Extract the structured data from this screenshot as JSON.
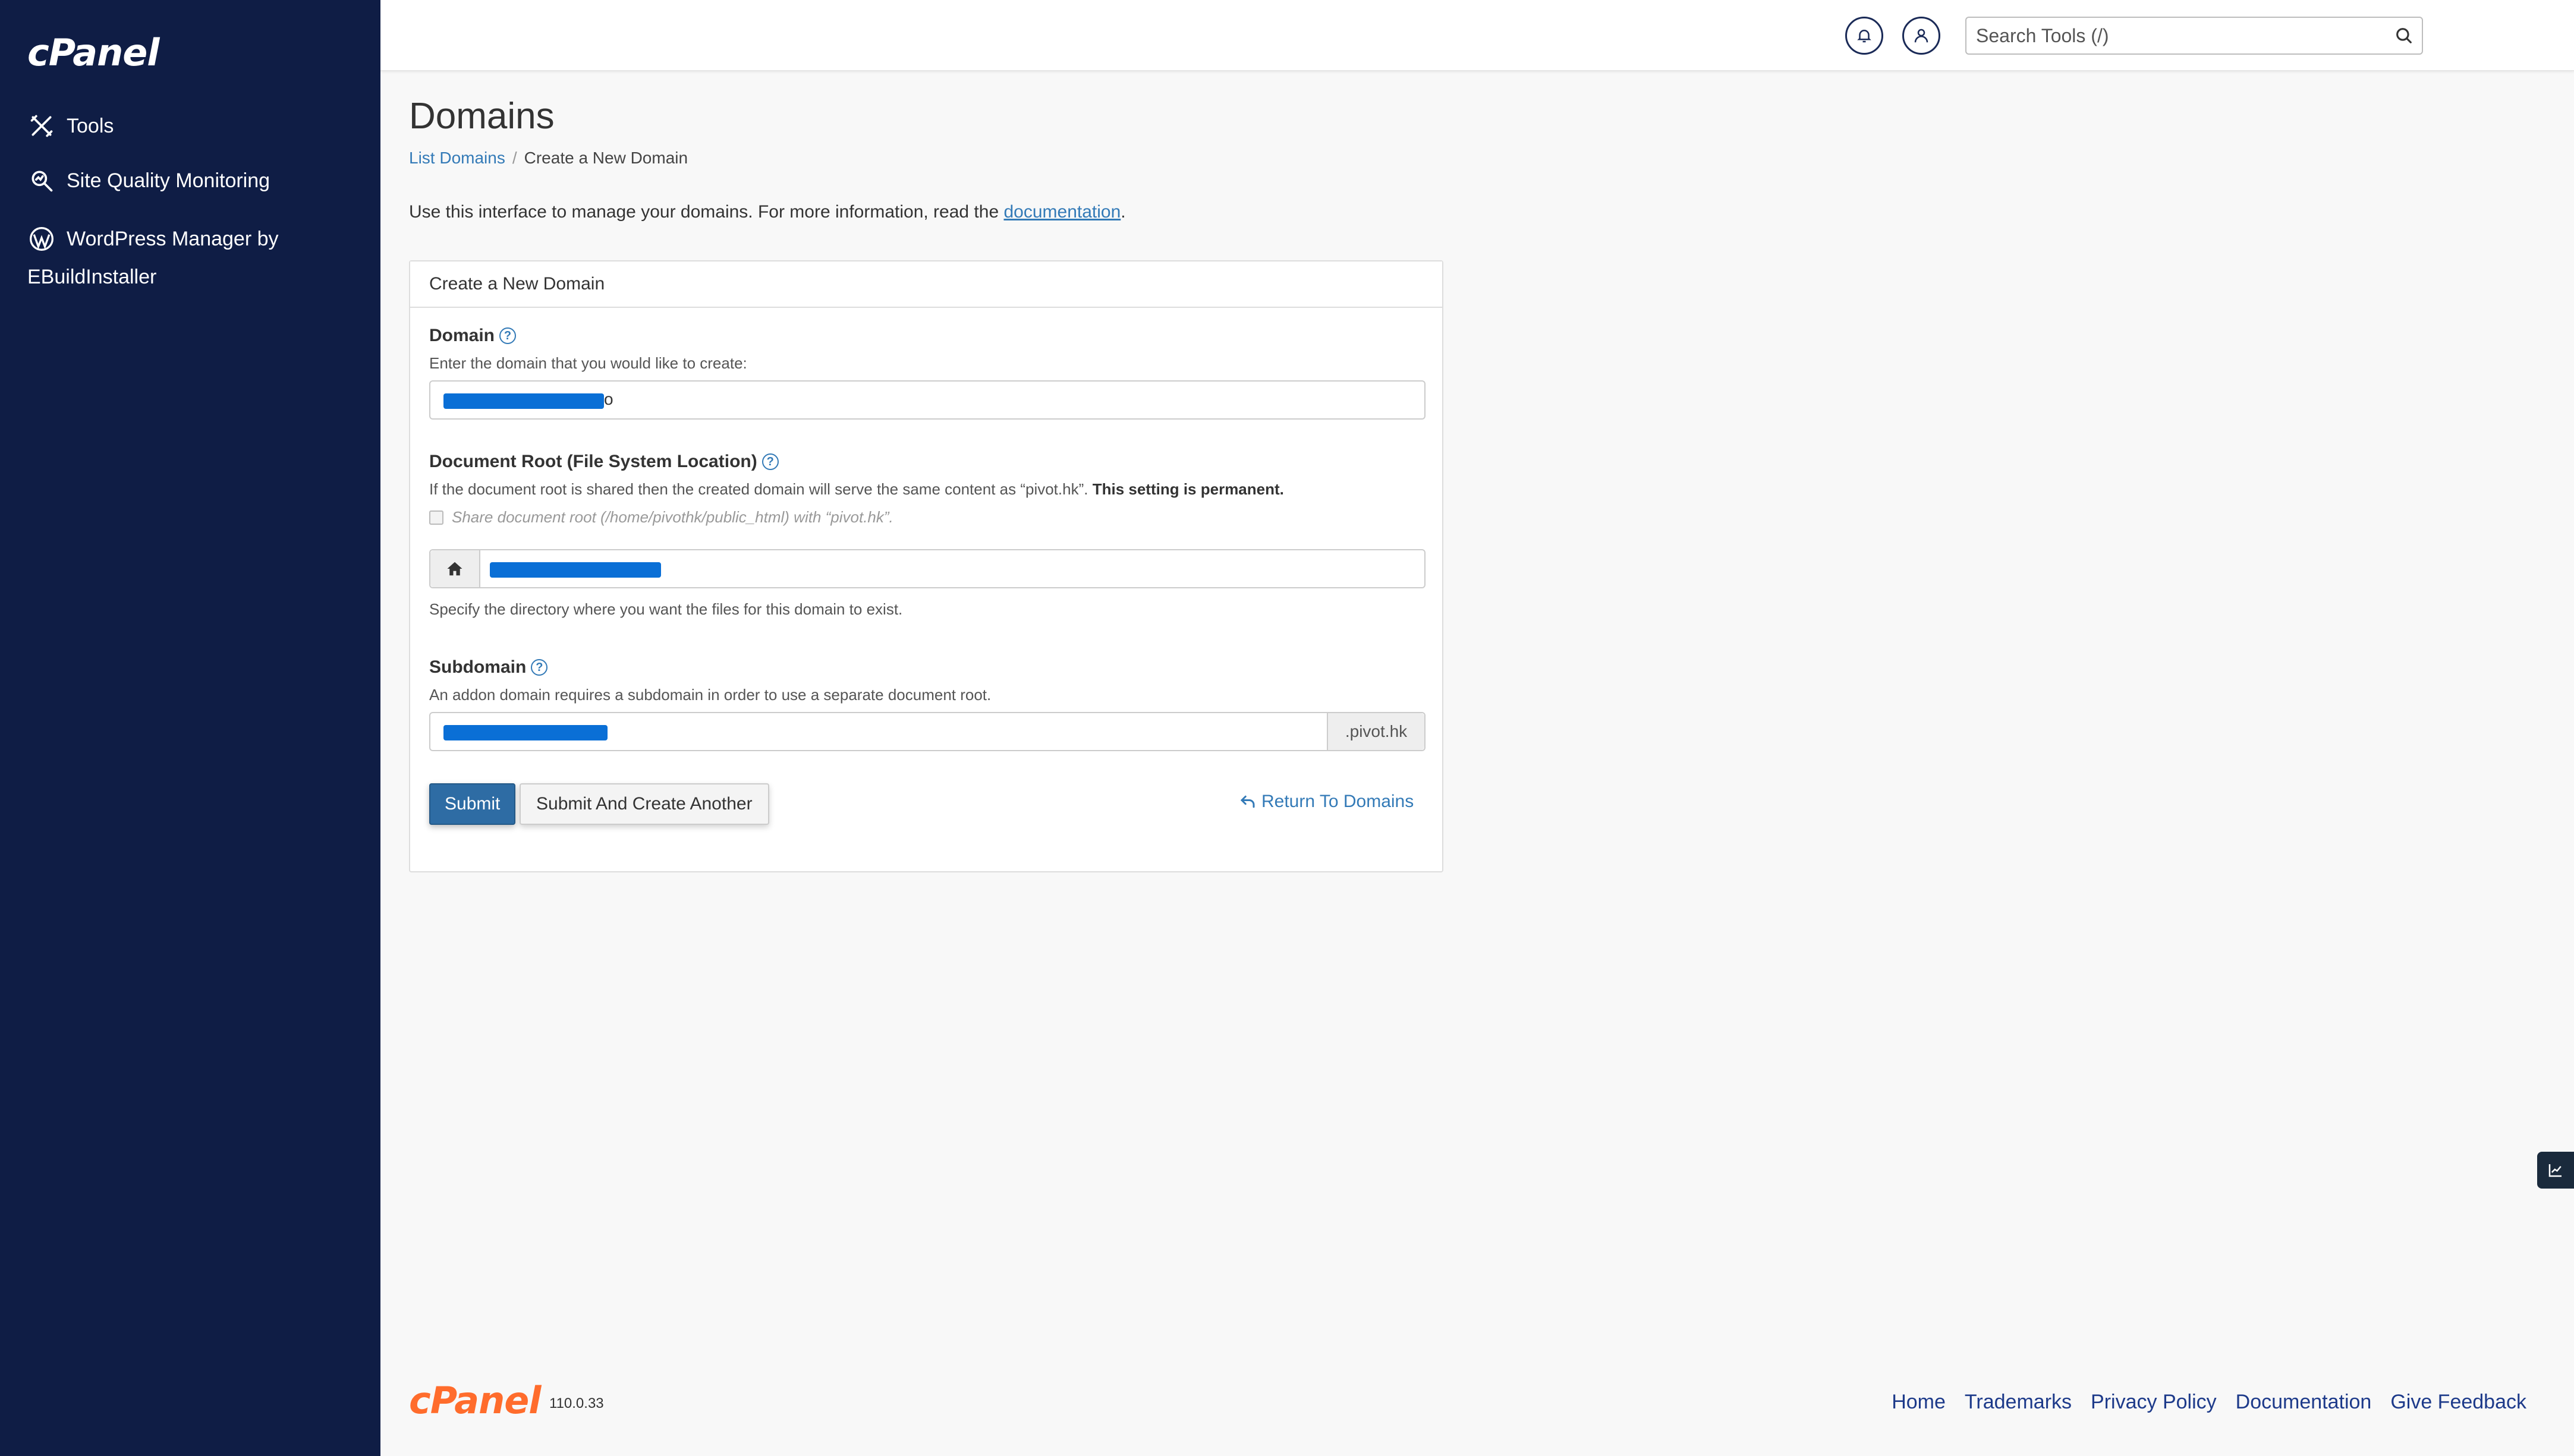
{
  "sidebar": {
    "logo": "cPanel",
    "items": [
      {
        "label": "Tools",
        "icon": "tools-icon"
      },
      {
        "label": "Site Quality Monitoring",
        "icon": "site-quality-icon"
      },
      {
        "label_line1": "WordPress Manager by",
        "label_line2": "EBuildInstaller",
        "icon": "wordpress-icon"
      }
    ]
  },
  "header": {
    "search_placeholder": "Search Tools (/)"
  },
  "page": {
    "title": "Domains",
    "breadcrumb": {
      "link": "List Domains",
      "separator": "/",
      "current": "Create a New Domain"
    },
    "intro_text": "Use this interface to manage your domains. For more information, read the",
    "intro_link": "documentation",
    "intro_end": "."
  },
  "form": {
    "panel_title": "Create a New Domain",
    "domain_label": "Domain",
    "domain_desc": "Enter the domain that you would like to create:",
    "domain_suffix_visible": "o",
    "docroot_label": "Document Root (File System Location)",
    "docroot_desc": "If the document root is shared then the created domain will serve the same content as “pivot.hk”.",
    "docroot_desc_bold": "This setting is permanent.",
    "share_checkbox_label": "Share document root (/home/pivothk/public_html) with “pivot.hk”.",
    "docroot_hint": "Specify the directory where you want the files for this domain to exist.",
    "subdomain_label": "Subdomain",
    "subdomain_desc": "An addon domain requires a subdomain in order to use a separate document root.",
    "subdomain_suffix": ".pivot.hk",
    "submit_label": "Submit",
    "submit_another_label": "Submit And Create Another",
    "return_label": "Return To Domains"
  },
  "footer": {
    "logo": "cPanel",
    "version": "110.0.33",
    "links": [
      "Home",
      "Trademarks",
      "Privacy Policy",
      "Documentation",
      "Give Feedback"
    ]
  },
  "colors": {
    "sidebar_bg": "#0f1d45",
    "primary": "#2e6ca4",
    "link": "#337ab7",
    "brand_orange": "#ff6c2c",
    "redaction": "#0a6fd6"
  }
}
